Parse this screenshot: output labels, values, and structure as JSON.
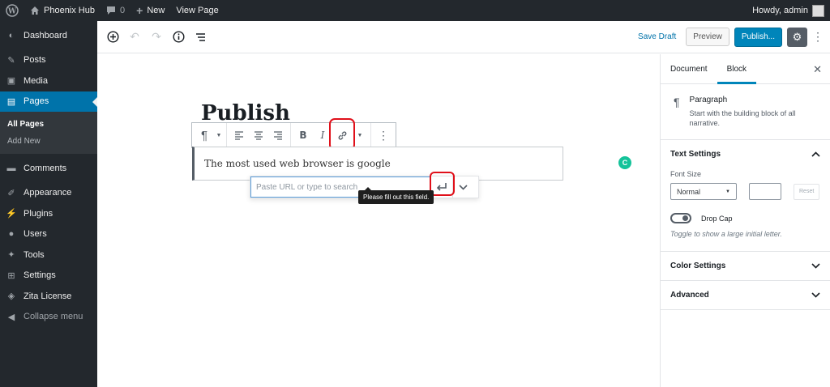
{
  "admin_bar": {
    "site_name": "Phoenix Hub",
    "comments_count": "0",
    "new_label": "New",
    "view_page_label": "View Page",
    "howdy": "Howdy, admin"
  },
  "sidebar": {
    "items": [
      {
        "label": "Dashboard",
        "icon": "dashboard-icon"
      },
      {
        "label": "Posts",
        "icon": "pin-icon"
      },
      {
        "label": "Media",
        "icon": "media-icon"
      },
      {
        "label": "Pages",
        "icon": "pages-icon"
      },
      {
        "label": "Comments",
        "icon": "comments-icon"
      },
      {
        "label": "Appearance",
        "icon": "appearance-icon"
      },
      {
        "label": "Plugins",
        "icon": "plugins-icon"
      },
      {
        "label": "Users",
        "icon": "users-icon"
      },
      {
        "label": "Tools",
        "icon": "tools-icon"
      },
      {
        "label": "Settings",
        "icon": "settings-icon"
      },
      {
        "label": "Zita License",
        "icon": "license-icon"
      }
    ],
    "submenu": [
      "All Pages",
      "Add New"
    ],
    "collapse_label": "Collapse menu"
  },
  "header": {
    "save_draft": "Save Draft",
    "preview": "Preview",
    "publish": "Publish..."
  },
  "editor": {
    "title": "Publish",
    "paragraph": "The most used web browser is google",
    "url_placeholder": "Paste URL or type to search",
    "tooltip": "Please fill out this field.",
    "grammarly": "C"
  },
  "settings_panel": {
    "tab_document": "Document",
    "tab_block": "Block",
    "block_name": "Paragraph",
    "block_desc": "Start with the building block of all narrative.",
    "text_settings": "Text Settings",
    "font_size_label": "Font Size",
    "font_size_value": "Normal",
    "reset_label": "Reset",
    "drop_cap_label": "Drop Cap",
    "drop_cap_help": "Toggle to show a large initial letter.",
    "color_settings": "Color Settings",
    "advanced": "Advanced"
  },
  "colors": {
    "admin_dark": "#23282d",
    "accent": "#0073aa",
    "publish": "#0085ba",
    "annotation_red": "#e0101a",
    "grammarly": "#15c39a"
  }
}
